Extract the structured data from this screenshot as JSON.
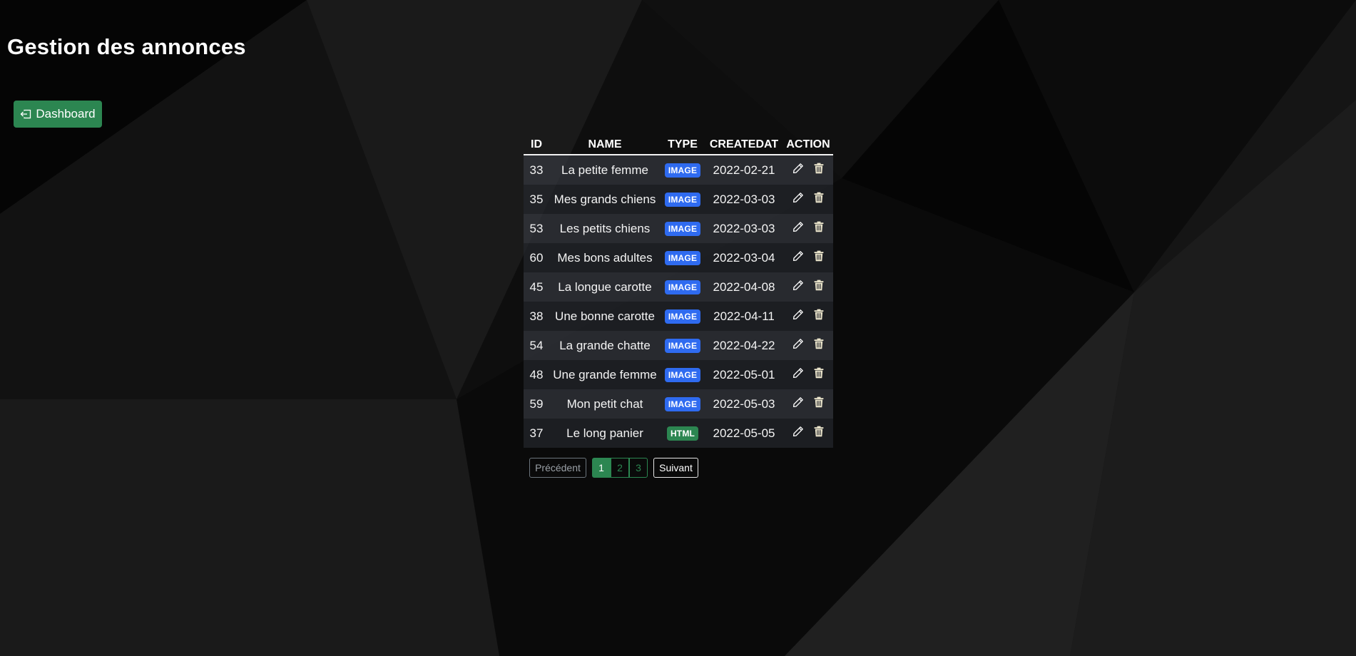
{
  "header": {
    "title": "Gestion des annonces"
  },
  "toolbar": {
    "dashboard_label": "Dashboard",
    "dashboard_icon": "box-arrow-left-icon",
    "dashboard_color": "#2c8651"
  },
  "table": {
    "columns": [
      "ID",
      "NAME",
      "TYPE",
      "CREATEDAT",
      "ACTION"
    ],
    "badge_colors": {
      "IMAGE": "#2f6bf0",
      "HTML": "#2c8651"
    },
    "rows": [
      {
        "id": "33",
        "name": "La petite femme",
        "type": "IMAGE",
        "created": "2022-02-21"
      },
      {
        "id": "35",
        "name": "Mes grands chiens",
        "type": "IMAGE",
        "created": "2022-03-03"
      },
      {
        "id": "53",
        "name": "Les petits chiens",
        "type": "IMAGE",
        "created": "2022-03-03"
      },
      {
        "id": "60",
        "name": "Mes bons adultes",
        "type": "IMAGE",
        "created": "2022-03-04"
      },
      {
        "id": "45",
        "name": "La longue carotte",
        "type": "IMAGE",
        "created": "2022-04-08"
      },
      {
        "id": "38",
        "name": "Une bonne carotte",
        "type": "IMAGE",
        "created": "2022-04-11"
      },
      {
        "id": "54",
        "name": "La grande chatte",
        "type": "IMAGE",
        "created": "2022-04-22"
      },
      {
        "id": "48",
        "name": "Une grande femme",
        "type": "IMAGE",
        "created": "2022-05-01"
      },
      {
        "id": "59",
        "name": "Mon petit chat",
        "type": "IMAGE",
        "created": "2022-05-03"
      },
      {
        "id": "37",
        "name": "Le long panier",
        "type": "HTML",
        "created": "2022-05-05"
      }
    ],
    "action_icons": [
      "pencil-icon",
      "trash-icon"
    ]
  },
  "pagination": {
    "prev_label": "Précédent",
    "next_label": "Suivant",
    "pages": [
      "1",
      "2",
      "3"
    ],
    "current_page": "1"
  }
}
